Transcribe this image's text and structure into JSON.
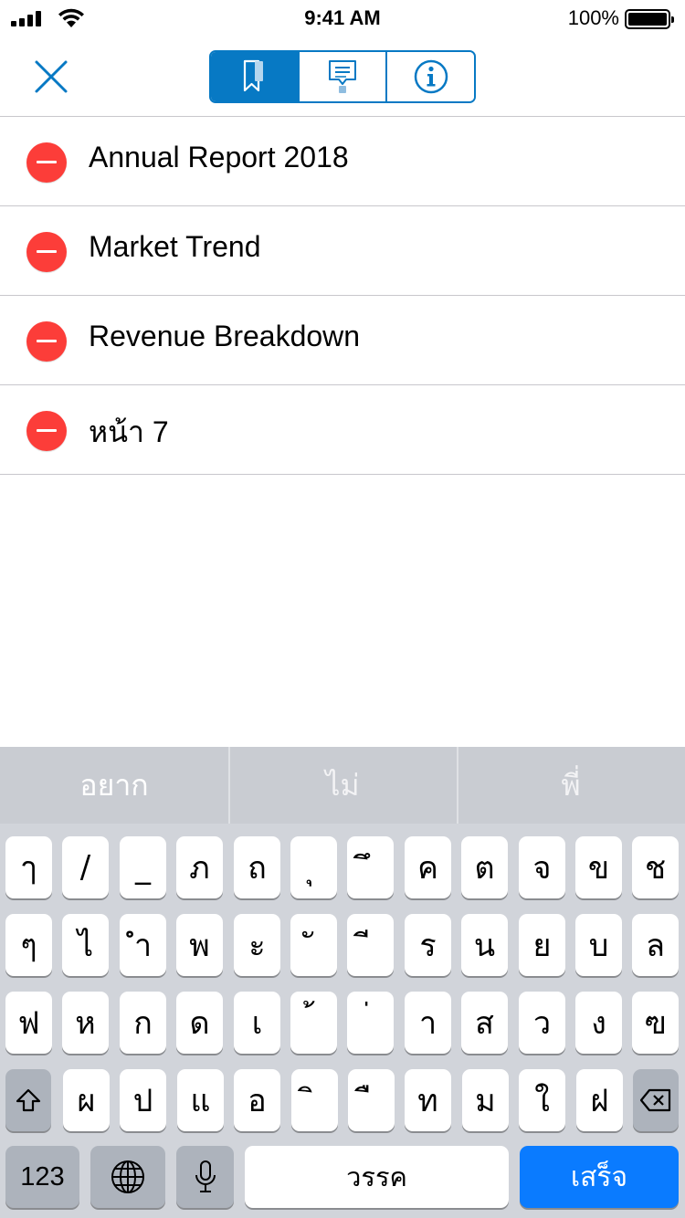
{
  "status_bar": {
    "time": "9:41 AM",
    "battery_percent": "100%",
    "battery_level": 1.0
  },
  "nav": {
    "close_icon": "close-icon",
    "tabs": [
      {
        "icon": "bookmark-icon",
        "active": true
      },
      {
        "icon": "comment-icon",
        "active": false
      },
      {
        "icon": "info-icon",
        "active": false
      }
    ],
    "accent_color": "#0779c4"
  },
  "bookmarks": [
    {
      "label": "Annual Report 2018"
    },
    {
      "label": "Market Trend"
    },
    {
      "label": "Revenue Breakdown"
    },
    {
      "label": "หน้า 7"
    }
  ],
  "delete_color": "#fc3d39",
  "keyboard": {
    "suggestions": [
      "อยาก",
      "ไม่",
      "พี่"
    ],
    "row1": [
      "ๅ",
      "/",
      "_",
      "ภ",
      "ถ",
      "ุ",
      "ึ",
      "ค",
      "ต",
      "จ",
      "ข",
      "ช"
    ],
    "row2": [
      "ๆ",
      "ไ",
      "ำ",
      "พ",
      "ะ",
      "ั",
      "ี",
      "ร",
      "น",
      "ย",
      "บ",
      "ล"
    ],
    "row3": [
      "ฟ",
      "ห",
      "ก",
      "ด",
      "เ",
      "้",
      "่",
      "า",
      "ส",
      "ว",
      "ง",
      "ฃ"
    ],
    "row4": [
      "ผ",
      "ป",
      "แ",
      "อ",
      "ิ",
      "ื",
      "ท",
      "ม",
      "ใ",
      "ฝ"
    ],
    "numbers_label": "123",
    "space_label": "วรรค",
    "done_label": "เสร็จ"
  }
}
